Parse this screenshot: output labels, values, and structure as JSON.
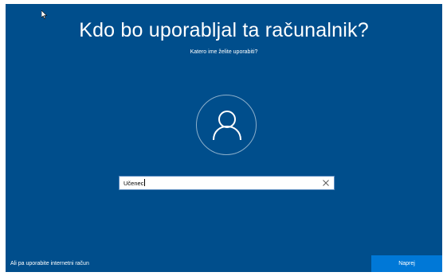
{
  "page": {
    "title": "Kdo bo uporabljal ta računalnik?",
    "subtitle": "Katero ime želite uporabiti?"
  },
  "avatar": {
    "icon": "person-icon"
  },
  "name_input": {
    "value": "Učenec",
    "clear_icon": "close-icon"
  },
  "footer": {
    "alt_link_label": "Ali pa uporabite internetni račun",
    "next_button_label": "Naprej"
  },
  "colors": {
    "background": "#004e8c",
    "accent_button": "#0078d7",
    "text": "#ffffff"
  }
}
